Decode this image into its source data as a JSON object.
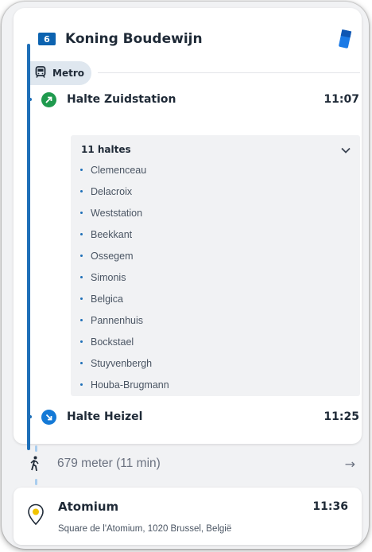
{
  "line": {
    "number": "6",
    "name": "Koning Boudewijn",
    "badge_color": "#0c63b0"
  },
  "mode": {
    "label": "Metro"
  },
  "departure": {
    "name": "Halte Zuidstation",
    "time": "11:07",
    "circle_color": "#1f9a4e"
  },
  "intermediate": {
    "count_label": "11 haltes",
    "stops": [
      "Clemenceau",
      "Delacroix",
      "Weststation",
      "Beekkant",
      "Ossegem",
      "Simonis",
      "Belgica",
      "Pannenhuis",
      "Bockstael",
      "Stuyvenbergh",
      "Houba-Brugmann"
    ]
  },
  "arrival": {
    "name": "Halte Heizel",
    "time": "11:25",
    "circle_color": "#1479d6"
  },
  "walk": {
    "text": "679 meter (11 min)",
    "arrow": "→"
  },
  "destination": {
    "name": "Atomium",
    "time": "11:36",
    "address": "Square de l'Atomium, 1020 Brussel, België"
  },
  "colors": {
    "route_line": "#1e6fb8",
    "walk_dots": "#a9cdee",
    "pin": "#f2c400"
  }
}
